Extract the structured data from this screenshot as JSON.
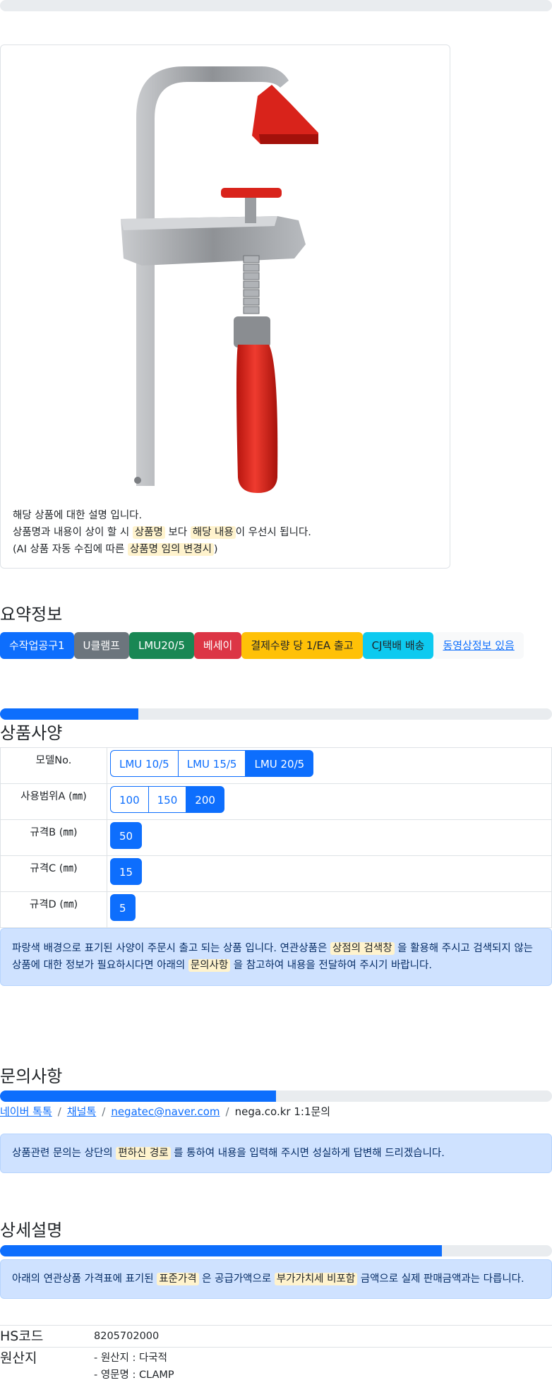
{
  "product": {
    "description": {
      "line1": "해당 상품에 대한 설명 입니다.",
      "line2_pre": "상품명과 내용이 상이 할 시 ",
      "line2_hl1": "상품명",
      "line2_mid": " 보다 ",
      "line2_hl2": "해당 내용",
      "line2_post": "이 우선시 됩니다.",
      "line3_pre": "(AI 상품 자동 수집에 따른 ",
      "line3_hl": "상품명 임의 변경시",
      "line3_post": ")"
    },
    "image_colors": {
      "frame": "#9ea1a5",
      "handle": "#e1261c"
    }
  },
  "summary": {
    "title": "요약정보",
    "badges": [
      "수작업공구1",
      "U클램프",
      "LMU20/5",
      "베세이",
      "결제수량 당 1/EA 출고",
      "CJ택배 배송",
      "동영상정보 있음"
    ]
  },
  "spec": {
    "progress": 0.25,
    "title": "상품사양",
    "rows": [
      {
        "label": "모델No.",
        "options": [
          "LMU 10/5",
          "LMU 15/5",
          "LMU 20/5"
        ],
        "selected": "LMU 20/5"
      },
      {
        "label": "사용범위A (㎜)",
        "options": [
          "100",
          "150",
          "200"
        ],
        "selected": "200"
      },
      {
        "label": "규격B (㎜)",
        "options": [
          "50"
        ],
        "selected": "50"
      },
      {
        "label": "규격C (㎜)",
        "options": [
          "15"
        ],
        "selected": "15"
      },
      {
        "label": "규격D (㎜)",
        "options": [
          "5"
        ],
        "selected": "5"
      }
    ],
    "notice": {
      "pre": "파랑색 배경으로 표기된 사양이 주문시 출고 되는 상품 입니다. 연관상품은 ",
      "hl1": "상점의 검색창",
      "mid": " 을 활용해 주시고 검색되지 않는 상품에 대한 정보가 필요하시다면 아래의 ",
      "hl2": "문의사항",
      "post": " 을 참고하여 내용을 전달하여 주시기 바랍니다."
    }
  },
  "inquiry": {
    "title": "문의사항",
    "progress": 0.5,
    "links": [
      "네이버 톡톡",
      "채널톡",
      "negatec@naver.com"
    ],
    "current": "nega.co.kr 1:1문의",
    "notice": {
      "pre": "상품관련 문의는 상단의 ",
      "hl": "편하신 경로",
      "post": " 를 통하여 내용을 입력해 주시면 성실하게 답변해 드리겠습니다."
    }
  },
  "detail": {
    "title": "상세설명",
    "progress": 0.8,
    "notice": {
      "pre": "아래의 연관상품 가격표에 표기된 ",
      "hl1": "표준가격",
      "mid": " 은 공급가액으로 ",
      "hl2": "부가가치세 비포함",
      "post": " 금액으로 실제 판매금액과는 다릅니다."
    },
    "hs_label": "HS코드",
    "hs_value": "8205702000",
    "origin_label": "원산지",
    "origin_line1": "- 원산지 : 다국적",
    "origin_line2": "- 영문명 : CLAMP"
  },
  "colors": {
    "primary": "#0d6efd",
    "highlight": "#fff3cd",
    "alert_bg": "#cfe2ff"
  }
}
